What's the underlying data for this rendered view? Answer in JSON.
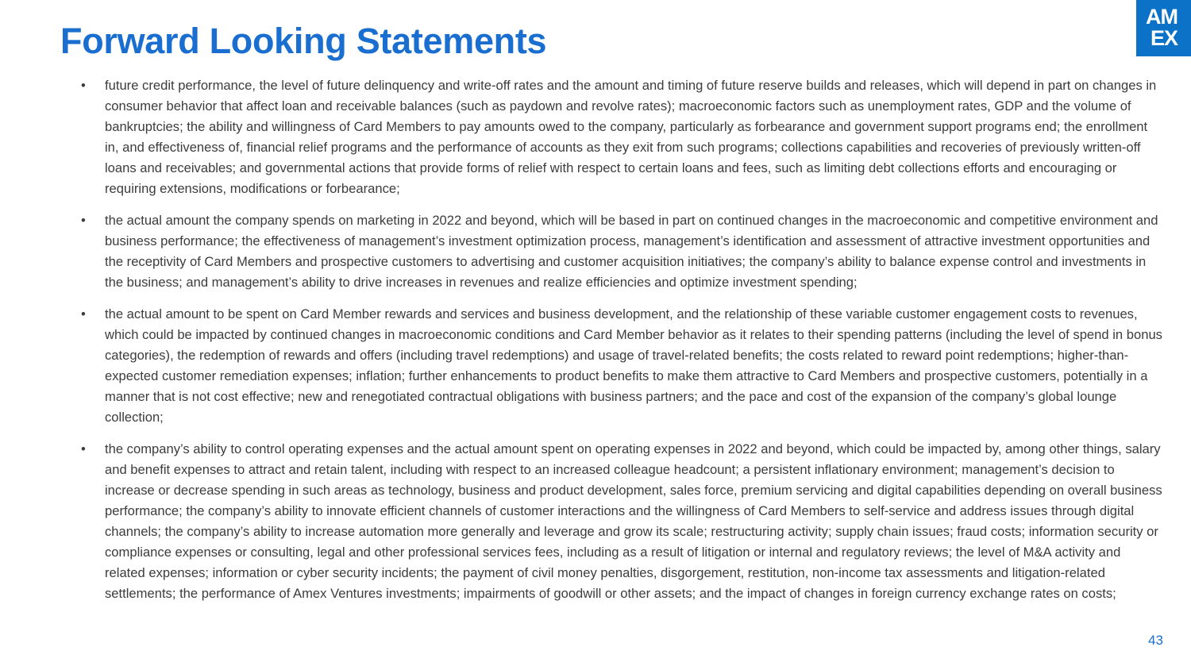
{
  "slide": {
    "title": "Forward Looking Statements",
    "page_number": "43",
    "bullet_symbol": "•",
    "logo": {
      "line1": "AM",
      "line2": "EX",
      "background": "#0b72c7"
    },
    "colors": {
      "title": "#1a6ed0",
      "body_text": "#3c3c3c"
    },
    "bullets": [
      "future credit performance, the level of future delinquency and write-off rates and the amount and timing of future reserve builds and releases, which will depend in part on changes in consumer behavior that affect loan and receivable balances (such as paydown and revolve rates); macroeconomic factors such as unemployment rates, GDP and the volume of bankruptcies; the ability and willingness of Card Members to pay amounts owed to the company, particularly as forbearance and government support programs end; the enrollment in, and effectiveness of, financial relief programs and  the performance of accounts as they exit from such programs; collections capabilities and recoveries of previously written-off loans and receivables; and governmental actions that provide forms of relief with respect to certain loans and fees, such as limiting debt collections efforts and encouraging or requiring extensions, modifications or forbearance;",
      "the actual amount the company spends on marketing in 2022 and beyond, which will be based in part on continued changes in the macroeconomic and competitive environment and business performance; the effectiveness of management’s investment optimization process, management’s identification and assessment of attractive investment opportunities and the receptivity of Card Members and prospective customers to advertising and customer acquisition initiatives; the company’s ability to balance expense control and investments in the business; and management’s ability to drive increases in revenues and realize efficiencies and optimize investment spending;",
      "the actual amount to be spent on Card Member rewards and services and business development, and the relationship of these variable customer engagement costs to revenues, which could be impacted by continued changes in macroeconomic conditions and Card Member behavior as it relates to their spending patterns (including the level of spend in bonus categories), the redemption of rewards and offers (including travel redemptions) and usage of travel-related benefits; the costs related to reward point redemptions; higher-than-expected customer remediation expenses; inflation; further enhancements to product benefits to make them attractive to Card Members and prospective customers, potentially in a manner that is not cost effective; new and renegotiated contractual obligations with business partners; and the pace and cost of the expansion of the company’s global lounge collection;",
      "the company’s ability to control operating expenses and the actual amount spent on operating expenses in 2022 and beyond, which could be impacted by, among other things, salary and benefit expenses to attract and retain talent, including with respect to an increased colleague headcount; a persistent inflationary environment; management’s decision to increase or decrease spending in such areas as technology, business and product development, sales force, premium servicing and digital capabilities depending on overall business performance; the company’s ability to innovate efficient channels of customer interactions and the willingness of Card Members to self-service and address issues through digital channels; the company’s ability to increase automation more generally and leverage and grow its scale; restructuring activity; supply chain issues; fraud costs; information security or compliance expenses or consulting, legal and other professional services fees, including as a result of litigation or internal and regulatory reviews; the level of M&A activity and related expenses; information or cyber security incidents; the payment of civil money penalties, disgorgement, restitution, non-income tax assessments and litigation-related settlements; the performance of Amex Ventures investments; impairments of goodwill or other assets; and the impact of changes in foreign currency exchange rates on costs;"
    ]
  }
}
